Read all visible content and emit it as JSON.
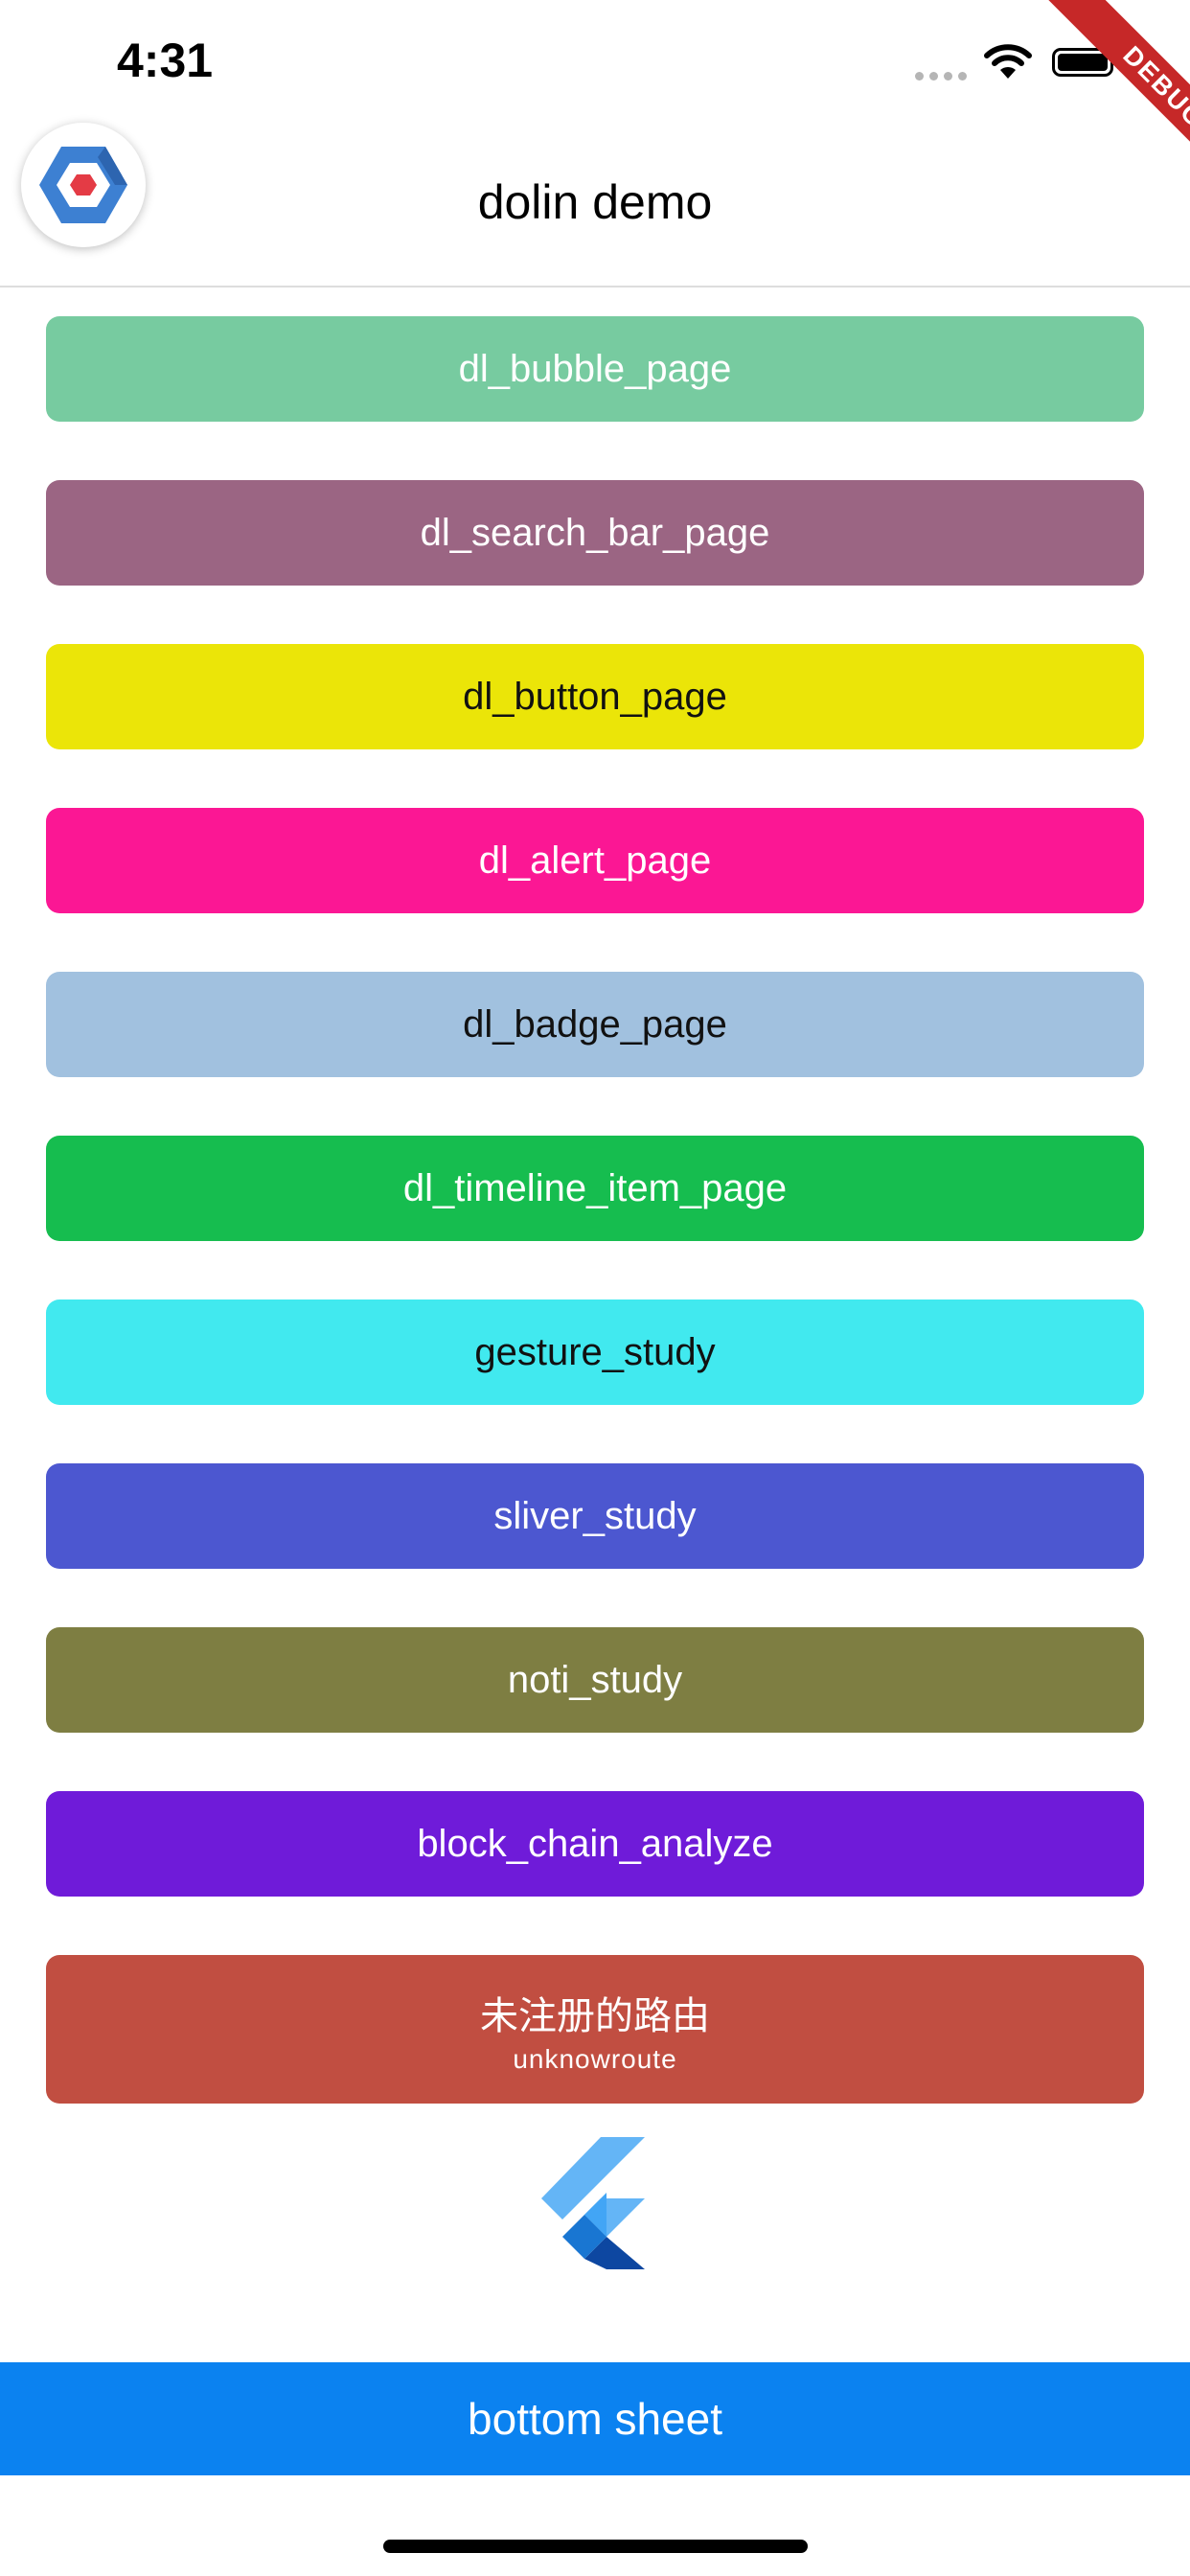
{
  "status_bar": {
    "time": "4:31",
    "debug_label": "DEBUG"
  },
  "app_bar": {
    "title": "dolin demo",
    "logo_icon": "hexagon-logo-icon"
  },
  "buttons": [
    {
      "label": "dl_bubble_page",
      "color": "#77cba0",
      "text_color": "#ffffff"
    },
    {
      "label": "dl_search_bar_page",
      "color": "#9b6583",
      "text_color": "#ffffff"
    },
    {
      "label": "dl_button_page",
      "color": "#ebe508",
      "text_color": "#111111"
    },
    {
      "label": "dl_alert_page",
      "color": "#fb1794",
      "text_color": "#ffffff"
    },
    {
      "label": "dl_badge_page",
      "color": "#a1c1df",
      "text_color": "#111111"
    },
    {
      "label": "dl_timeline_item_page",
      "color": "#16bd4f",
      "text_color": "#ffffff"
    },
    {
      "label": "gesture_study",
      "color": "#41e9ef",
      "text_color": "#111111"
    },
    {
      "label": "sliver_study",
      "color": "#4c57d0",
      "text_color": "#ffffff"
    },
    {
      "label": "noti_study",
      "color": "#7e7e42",
      "text_color": "#ffffff"
    },
    {
      "label": "block_chain_analyze",
      "color": "#6f1bd9",
      "text_color": "#ffffff"
    },
    {
      "label": "未注册的路由",
      "sublabel": "unknowroute",
      "color": "#c14e41",
      "text_color": "#ffffff"
    }
  ],
  "footer_logo": "flutter-logo-icon",
  "bottom_sheet_button": {
    "label": "bottom sheet",
    "color": "#0b82f0"
  }
}
